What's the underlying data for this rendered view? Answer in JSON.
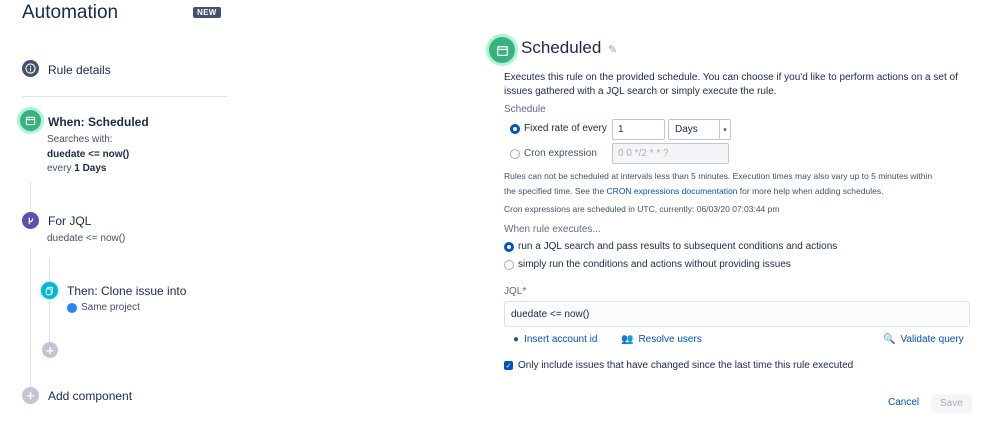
{
  "app": {
    "title": "Automation",
    "badge": "NEW"
  },
  "sidebar": {
    "rule_details": "Rule details",
    "when": {
      "title": "When: Scheduled",
      "searches_with": "Searches with:",
      "query": "duedate <= now()",
      "every_prefix": "every",
      "every_value": "1 Days"
    },
    "for_jql": {
      "title": "For JQL",
      "query": "duedate <= now()"
    },
    "then": {
      "title": "Then: Clone issue into",
      "target": "Same project"
    },
    "add_component": "Add component"
  },
  "panel": {
    "title": "Scheduled",
    "description": "Executes this rule on the provided schedule. You can choose if you'd like to perform actions on a set of issues gathered with a JQL search or simply execute the rule.",
    "schedule_label": "Schedule",
    "fixed_rate_label": "Fixed rate of every",
    "fixed_rate_value": "1",
    "unit_value": "Days",
    "cron_label": "Cron expression",
    "cron_placeholder": "0 0 */2 * * ?",
    "note_line1": "Rules can not be scheduled at intervals less than 5 minutes. Execution times may also vary up to 5 minutes within",
    "note_line2_pre": "the specified time. See the",
    "note_link": "CRON expressions documentation",
    "note_line2_post": "for more help when adding schedules.",
    "utc_note": "Cron expressions are scheduled in UTC, currently: 06/03/20 07:03:44 pm",
    "when_executes_label": "When rule executes...",
    "option_jql": "run a JQL search and pass results to subsequent conditions and actions",
    "option_simple": "simply run the conditions and actions without providing issues",
    "jql_label": "JQL",
    "jql_required": "*",
    "jql_value": "duedate <= now()",
    "insert_account": "Insert account id",
    "resolve_users": "Resolve users",
    "validate_query": "Validate query",
    "only_include": "Only include issues that have changed since the last time this rule executed",
    "cancel": "Cancel",
    "save": "Save"
  },
  "colors": {
    "accent": "#0052cc",
    "success": "#36b37e",
    "jql_purple": "#5e4db2",
    "clone_teal": "#00b8d9"
  }
}
